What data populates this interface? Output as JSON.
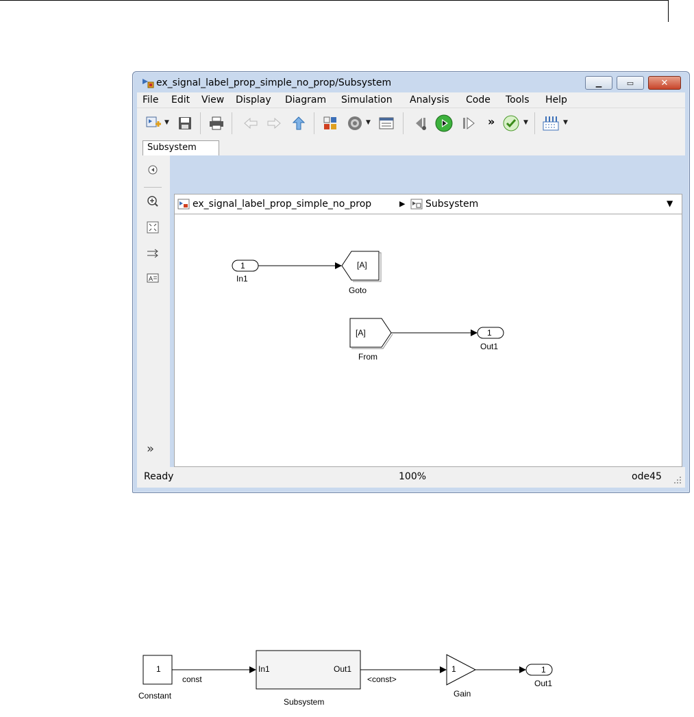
{
  "window": {
    "title": "ex_signal_label_prop_simple_no_prop/Subsystem",
    "controls": [
      "minimize",
      "maximize",
      "close"
    ]
  },
  "menu": [
    "File",
    "Edit",
    "View",
    "Display",
    "Diagram",
    "Simulation",
    "Analysis",
    "Code",
    "Tools",
    "Help"
  ],
  "toolbar": {
    "overflow_label": "»",
    "icons": [
      "new-model-icon",
      "save-icon",
      "print-icon",
      "back-arrow-icon",
      "forward-arrow-icon",
      "up-arrow-icon",
      "library-browser-icon",
      "gear-icon",
      "model-explorer-icon",
      "step-back-icon",
      "run-icon",
      "step-forward-icon",
      "check-icon",
      "build-icon"
    ]
  },
  "tabs": [
    {
      "label": "Subsystem"
    }
  ],
  "breadcrumb": {
    "root": "ex_signal_label_prop_simple_no_prop",
    "child": "Subsystem"
  },
  "leftbar": {
    "expand_label": "»"
  },
  "subsystem_diagram": {
    "in1": {
      "number": "1",
      "label": "In1"
    },
    "goto": {
      "tag": "[A]",
      "label": "Goto"
    },
    "from": {
      "tag": "[A]",
      "label": "From"
    },
    "out1": {
      "number": "1",
      "label": "Out1"
    }
  },
  "status": {
    "state": "Ready",
    "zoom": "100%",
    "solver": "ode45"
  },
  "top_diagram": {
    "constant": {
      "value": "1",
      "label": "Constant"
    },
    "signal1": "const",
    "subsystem": {
      "label": "Subsystem",
      "in_port": "In1",
      "out_port": "Out1"
    },
    "signal2": "<const>",
    "gain": {
      "value": "1",
      "label": "Gain"
    },
    "out1": {
      "number": "1",
      "label": "Out1"
    }
  },
  "colors": {
    "window_frame": "#c9d9ee",
    "chrome": "#f0f0f0",
    "close_button": "#c8442a",
    "run_button": "#3db13d"
  }
}
